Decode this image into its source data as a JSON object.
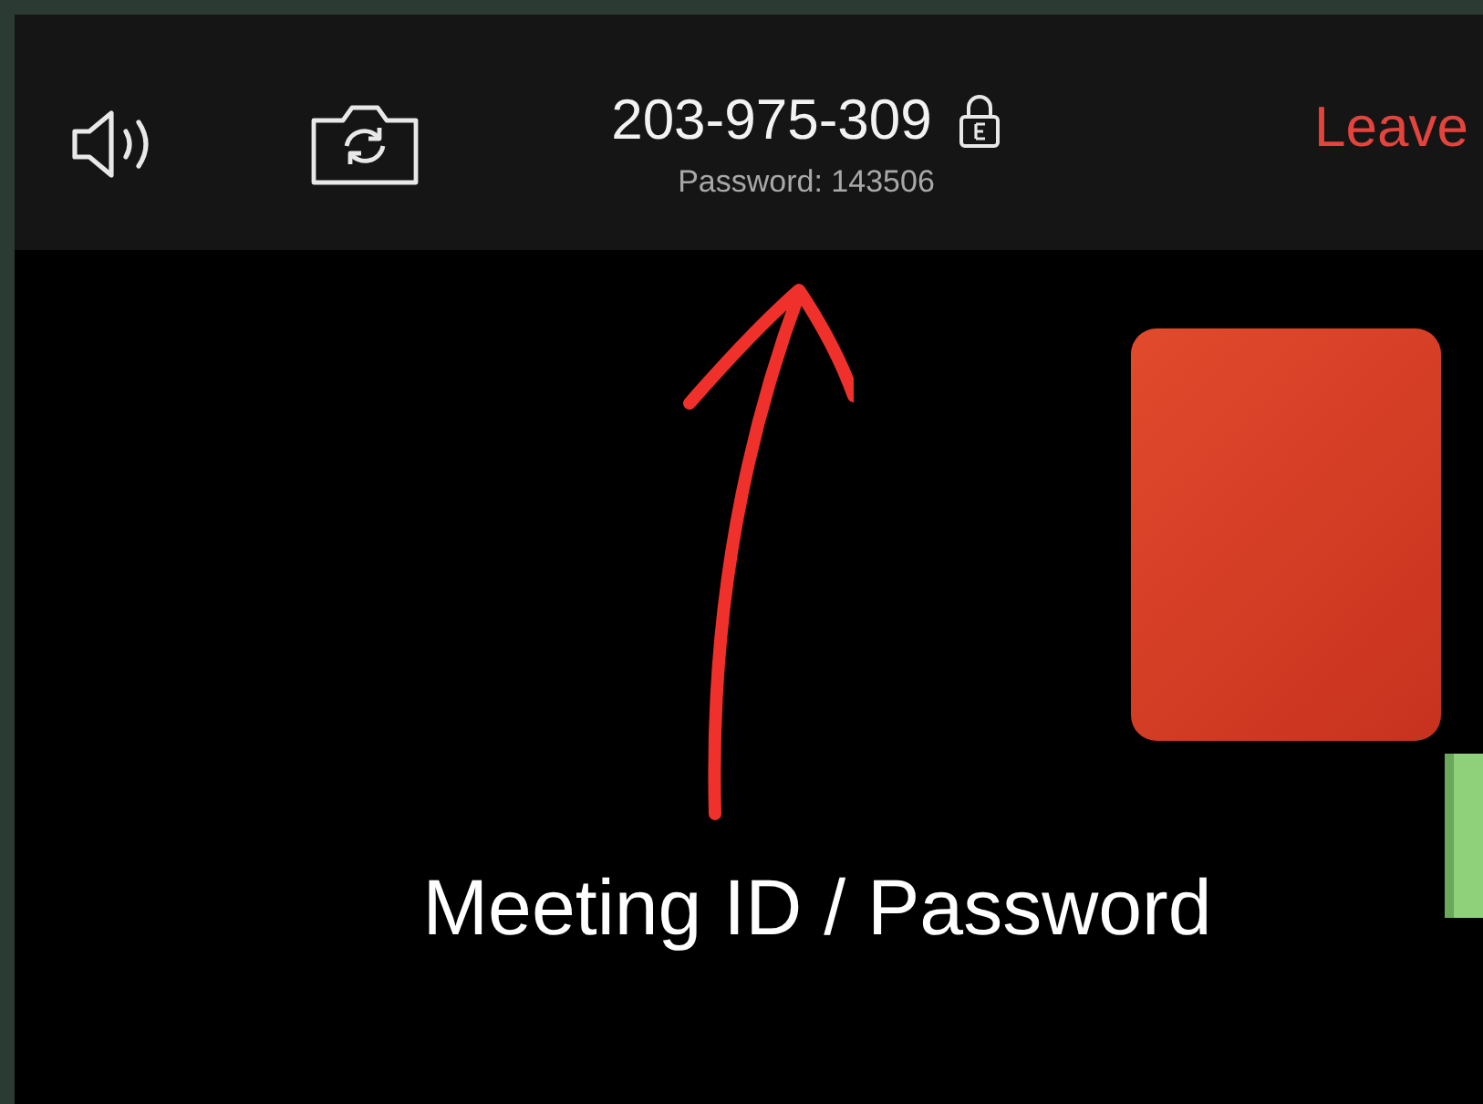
{
  "toolbar": {
    "meeting_id": "203-975-309",
    "password": "Password: 143506",
    "leave_button": "Leave"
  },
  "annotation": {
    "caption": "Meeting ID / Password"
  }
}
